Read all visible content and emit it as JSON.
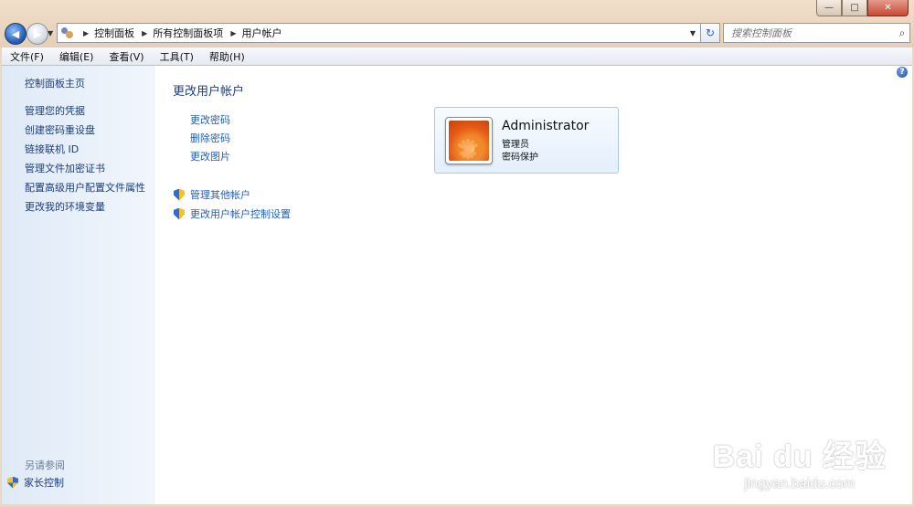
{
  "window": {
    "min": "—",
    "max": "□",
    "close": "✕"
  },
  "nav": {
    "back": "◀",
    "forward": "▶"
  },
  "address": {
    "crumbs": [
      "控制面板",
      "所有控制面板项",
      "用户帐户"
    ]
  },
  "search": {
    "placeholder": "搜索控制面板"
  },
  "menu": [
    "文件(F)",
    "编辑(E)",
    "查看(V)",
    "工具(T)",
    "帮助(H)"
  ],
  "sidebar": {
    "home": "控制面板主页",
    "tasks": [
      "管理您的凭据",
      "创建密码重设盘",
      "链接联机 ID",
      "管理文件加密证书",
      "配置高级用户配置文件属性",
      "更改我的环境变量"
    ],
    "see_also": "另请参阅",
    "family": "家长控制"
  },
  "main": {
    "title": "更改用户帐户",
    "links": [
      "更改密码",
      "删除密码",
      "更改图片"
    ],
    "admin_links": [
      "管理其他帐户",
      "更改用户帐户控制设置"
    ],
    "help": "?"
  },
  "account": {
    "name": "Administrator",
    "role": "管理员",
    "status": "密码保护"
  },
  "watermark": {
    "line1": "Bai du 经验",
    "line2": "jingyan.baidu.com"
  },
  "colors": {
    "link": "#1f5fbf",
    "title": "#1c3f88",
    "sidebar_link": "#1d3e7a"
  }
}
